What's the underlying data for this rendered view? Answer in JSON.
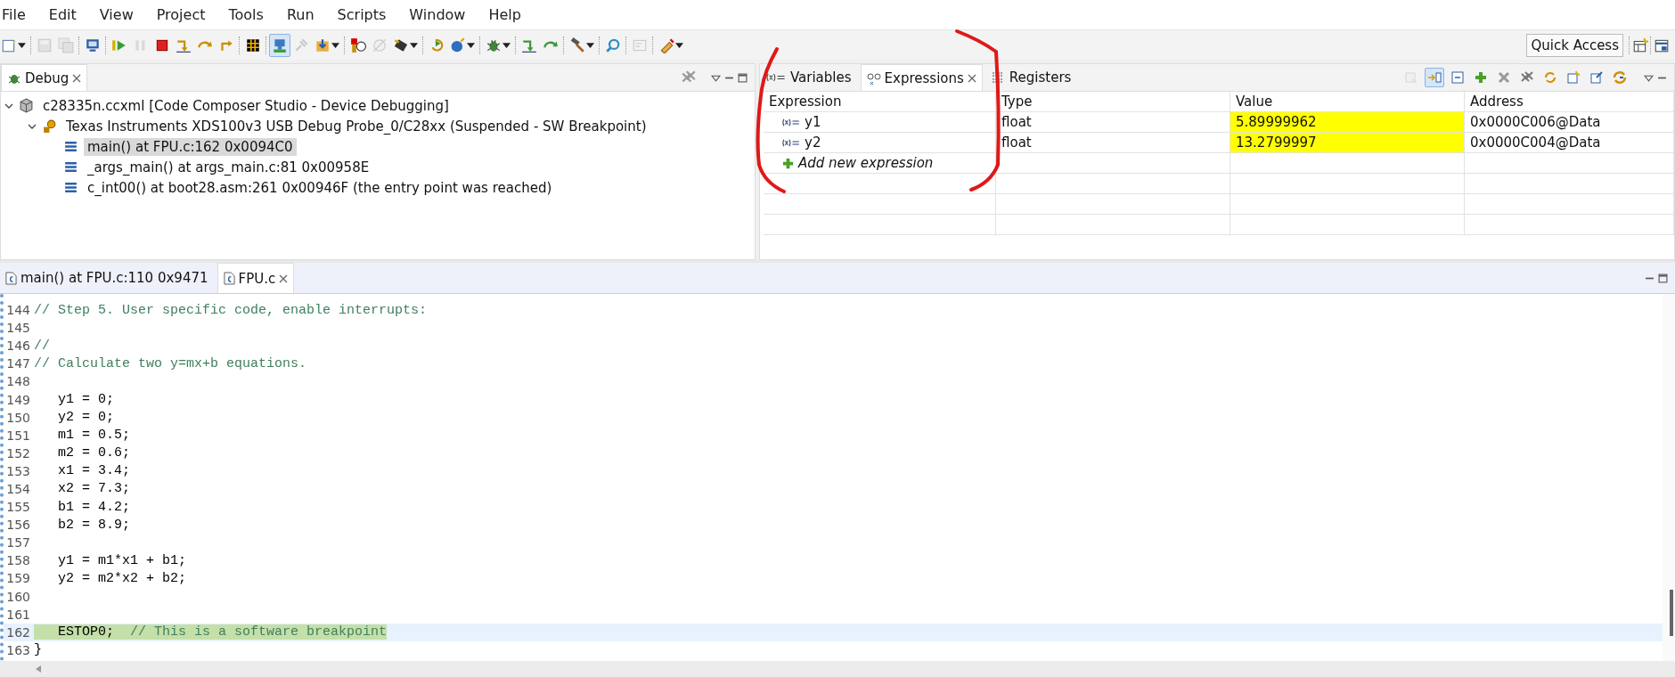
{
  "menu": [
    "File",
    "Edit",
    "View",
    "Project",
    "Tools",
    "Run",
    "Scripts",
    "Window",
    "Help"
  ],
  "toolbar": [
    {
      "kind": "button",
      "dropdown": true,
      "selected": false,
      "disabled": false
    },
    {
      "kind": "separator"
    },
    {
      "kind": "button",
      "dropdown": false,
      "selected": false,
      "disabled": true
    },
    {
      "kind": "button",
      "dropdown": false,
      "selected": false,
      "disabled": true
    },
    {
      "kind": "separator"
    },
    {
      "kind": "button",
      "dropdown": false,
      "selected": false,
      "disabled": false
    },
    {
      "kind": "separator"
    },
    {
      "kind": "button",
      "dropdown": false,
      "selected": false,
      "disabled": false
    },
    {
      "kind": "button",
      "dropdown": false,
      "selected": false,
      "disabled": true
    },
    {
      "kind": "button",
      "dropdown": false,
      "selected": false,
      "disabled": false
    },
    {
      "kind": "button",
      "dropdown": false,
      "selected": false,
      "disabled": false
    },
    {
      "kind": "button",
      "dropdown": false,
      "selected": false,
      "disabled": false
    },
    {
      "kind": "button",
      "dropdown": false,
      "selected": false,
      "disabled": false
    },
    {
      "kind": "separator"
    },
    {
      "kind": "button",
      "dropdown": false,
      "selected": false,
      "disabled": false
    },
    {
      "kind": "separator"
    },
    {
      "kind": "button",
      "dropdown": false,
      "selected": true,
      "disabled": false
    },
    {
      "kind": "button",
      "dropdown": false,
      "selected": false,
      "disabled": true
    },
    {
      "kind": "button",
      "dropdown": true,
      "selected": false,
      "disabled": false
    },
    {
      "kind": "separator"
    },
    {
      "kind": "button",
      "dropdown": false,
      "selected": false,
      "disabled": false
    },
    {
      "kind": "button",
      "dropdown": false,
      "selected": false,
      "disabled": true
    },
    {
      "kind": "button",
      "dropdown": true,
      "selected": false,
      "disabled": false
    },
    {
      "kind": "separator"
    },
    {
      "kind": "button",
      "dropdown": false,
      "selected": false,
      "disabled": false
    },
    {
      "kind": "button",
      "dropdown": true,
      "selected": false,
      "disabled": false
    },
    {
      "kind": "separator"
    },
    {
      "kind": "button",
      "dropdown": true,
      "selected": false,
      "disabled": false
    },
    {
      "kind": "separator"
    },
    {
      "kind": "button",
      "dropdown": false,
      "selected": false,
      "disabled": false
    },
    {
      "kind": "button",
      "dropdown": false,
      "selected": false,
      "disabled": false
    },
    {
      "kind": "separator"
    },
    {
      "kind": "button",
      "dropdown": true,
      "selected": false,
      "disabled": false
    },
    {
      "kind": "separator"
    },
    {
      "kind": "button",
      "dropdown": false,
      "selected": false,
      "disabled": false
    },
    {
      "kind": "separator"
    },
    {
      "kind": "button",
      "dropdown": false,
      "selected": false,
      "disabled": true
    },
    {
      "kind": "separator"
    },
    {
      "kind": "button",
      "dropdown": true,
      "selected": false,
      "disabled": false
    }
  ],
  "quick_access": "Quick Access",
  "debug_panel": {
    "tabs": [
      {
        "label": "Debug",
        "selected": true
      }
    ],
    "tree": [
      {
        "label": "c28335n.ccxml [Code Composer Studio - Device Debugging]",
        "kind": "launch",
        "expanded": true,
        "selected": false,
        "children": [
          {
            "label": "Texas Instruments XDS100v3 USB Debug Probe_0/C28xx (Suspended - SW Breakpoint)",
            "kind": "device",
            "expanded": true,
            "selected": false,
            "children": [
              {
                "label": "main() at FPU.c:162 0x0094C0",
                "kind": "frame",
                "selected": true
              },
              {
                "label": "_args_main() at args_main.c:81 0x00958E",
                "kind": "frame",
                "selected": false
              },
              {
                "label": "c_int00() at boot28.asm:261 0x00946F  (the entry point was reached)",
                "kind": "frame",
                "selected": false
              }
            ]
          }
        ]
      }
    ]
  },
  "expressions_panel": {
    "tabs": [
      {
        "label": "Variables",
        "kind": "variables",
        "selected": false
      },
      {
        "label": "Expressions",
        "kind": "expressions",
        "selected": true
      },
      {
        "label": "Registers",
        "kind": "registers",
        "selected": false
      }
    ],
    "toolbar": [
      {
        "selected": false,
        "disabled": true
      },
      {
        "selected": true,
        "disabled": false
      },
      {
        "selected": false,
        "disabled": false
      },
      {
        "selected": false,
        "disabled": false
      },
      {
        "selected": false,
        "disabled": false
      },
      {
        "selected": false,
        "disabled": false
      },
      {
        "selected": false,
        "disabled": false
      },
      {
        "selected": false,
        "disabled": false
      },
      {
        "selected": false,
        "disabled": false
      },
      {
        "selected": false,
        "disabled": false
      }
    ],
    "columns": [
      "Expression",
      "Type",
      "Value",
      "Address"
    ],
    "rows": [
      {
        "kind": "variable",
        "expression": "y1",
        "type": "float",
        "value": "5.89999962",
        "address": "0x0000C006@Data",
        "changed": true
      },
      {
        "kind": "variable",
        "expression": "y2",
        "type": "float",
        "value": "13.2799997",
        "address": "0x0000C004@Data",
        "changed": true
      },
      {
        "kind": "add",
        "expression": "Add new expression"
      }
    ]
  },
  "editor": {
    "tabs": [
      {
        "label": "main() at FPU.c:110 0x9471",
        "selected": false,
        "closable": false
      },
      {
        "label": "FPU.c",
        "selected": true,
        "closable": true
      }
    ],
    "lines": [
      {
        "number": "144",
        "comment": "// Step 5. User specific code, enable interrupts:",
        "current": false
      },
      {
        "number": "145",
        "current": false
      },
      {
        "number": "146",
        "comment": "//",
        "current": false
      },
      {
        "number": "147",
        "comment": "// Calculate two y=mx+b equations.",
        "current": false
      },
      {
        "number": "148",
        "current": false
      },
      {
        "number": "149",
        "code": "   y1 = 0;",
        "current": false
      },
      {
        "number": "150",
        "code": "   y2 = 0;",
        "current": false
      },
      {
        "number": "151",
        "code": "   m1 = 0.5;",
        "current": false
      },
      {
        "number": "152",
        "code": "   m2 = 0.6;",
        "current": false
      },
      {
        "number": "153",
        "code": "   x1 = 3.4;",
        "current": false
      },
      {
        "number": "154",
        "code": "   x2 = 7.3;",
        "current": false
      },
      {
        "number": "155",
        "code": "   b1 = 4.2;",
        "current": false
      },
      {
        "number": "156",
        "code": "   b2 = 8.9;",
        "current": false
      },
      {
        "number": "157",
        "current": false
      },
      {
        "number": "158",
        "code": "   y1 = m1*x1 + b1;",
        "current": false
      },
      {
        "number": "159",
        "code": "   y2 = m2*x2 + b2;",
        "current": false
      },
      {
        "number": "160",
        "current": false
      },
      {
        "number": "161",
        "current": false
      },
      {
        "number": "162",
        "code": "   ESTOP0;  ",
        "comment": "// This is a software breakpoint",
        "current": true
      },
      {
        "number": "163",
        "code": "}",
        "current": false
      }
    ]
  }
}
